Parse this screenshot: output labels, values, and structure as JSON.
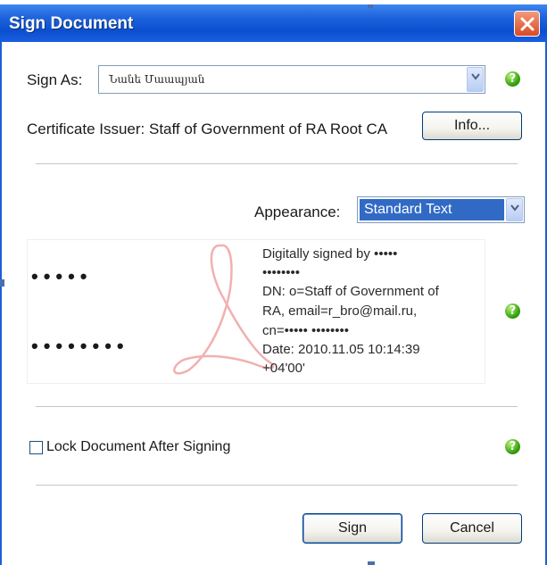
{
  "window": {
    "title": "Sign Document"
  },
  "sign_as": {
    "label": "Sign As:",
    "value": "Նանե Մաապյան"
  },
  "certificate": {
    "issuer_text": "Certificate Issuer: Staff of Government of RA Root CA",
    "info_button": "Info..."
  },
  "appearance": {
    "label": "Appearance:",
    "selected": "Standard Text"
  },
  "preview": {
    "name_dots_top": "•••••",
    "name_dots_bottom": "••••••••",
    "lines": [
      "Digitally signed by •••••",
      "••••••••",
      "DN: o=Staff of Government of",
      "RA, email=r_bro@mail.ru,",
      "cn=••••• ••••••••",
      "Date: 2010.11.05 10:14:39",
      "+04'00'"
    ]
  },
  "lock": {
    "label": "Lock Document After Signing",
    "checked": false
  },
  "buttons": {
    "sign": "Sign",
    "cancel": "Cancel"
  },
  "help_glyph": "?",
  "colors": {
    "titlebar": "#0b4fd0",
    "close": "#d84a26",
    "help": "#3aa511",
    "selection": "#316ac5"
  }
}
